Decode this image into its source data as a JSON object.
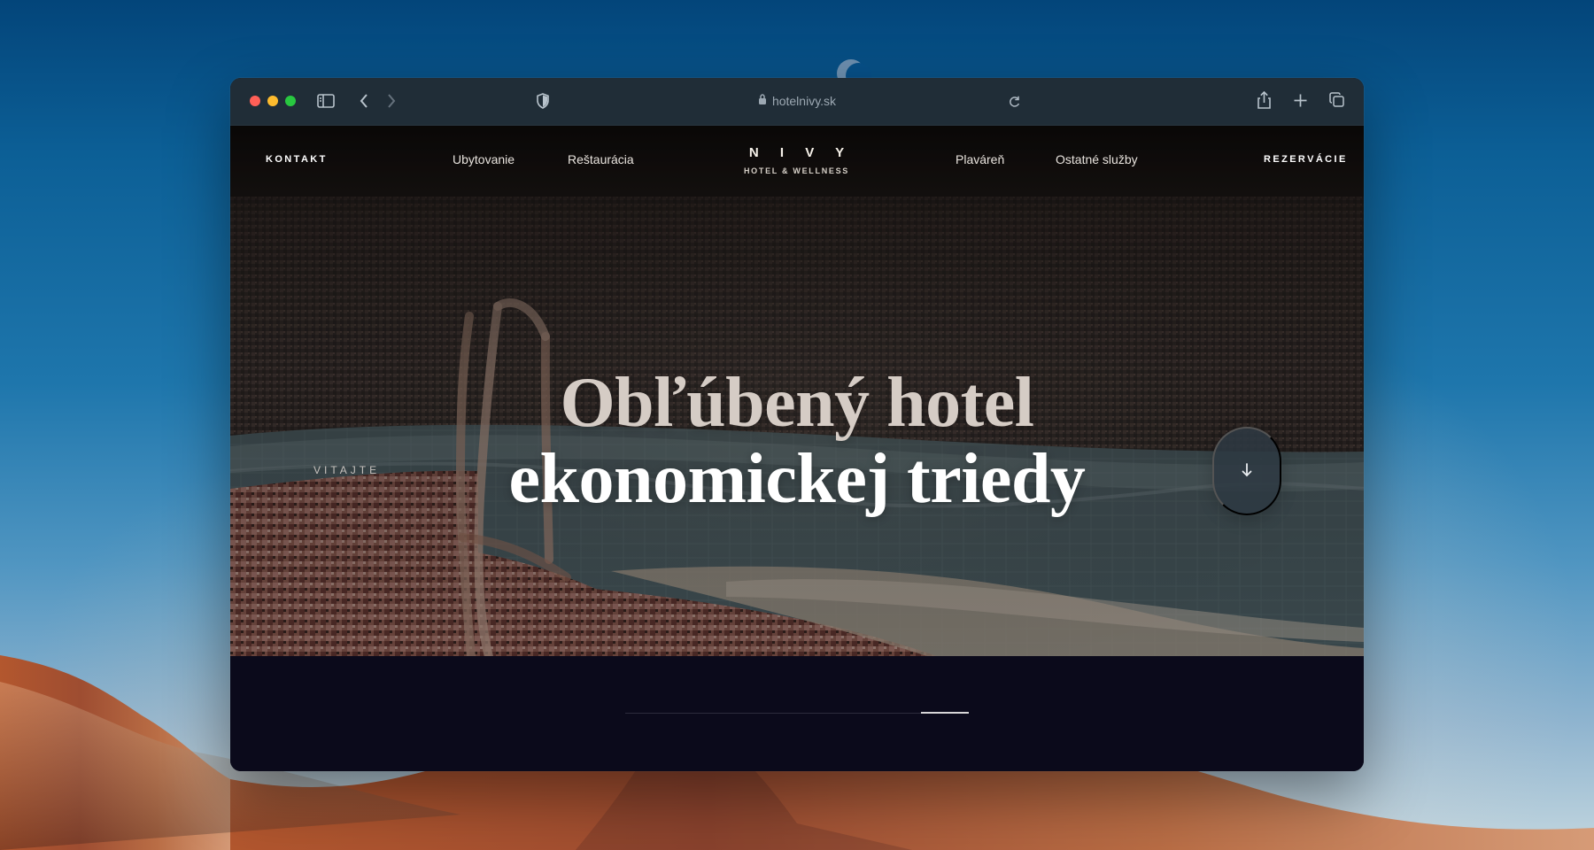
{
  "browser": {
    "url": "hotelnivy.sk",
    "forward_enabled": false
  },
  "navigation": {
    "contact_label": "KONTAKT",
    "accommodation_label": "Ubytovanie",
    "restaurant_label": "Reštaurácia",
    "pool_label": "Plaváreň",
    "other_services_label": "Ostatné služby",
    "reservations_label": "REZERVÁCIE"
  },
  "brand": {
    "name": "N I V Y",
    "subtitle": "HOTEL & WELLNESS"
  },
  "hero": {
    "welcome_label": "VITAJTE",
    "headline_line_1": "Obľúbený hotel",
    "headline_line_2": "ekonomickej triedy"
  },
  "slider": {
    "active_position": 0.86
  },
  "icons": {
    "sidebar": "sidebar-icon",
    "back": "chevron-left-icon",
    "forward": "chevron-right-icon",
    "privacy": "shield-icon",
    "lock": "lock-icon",
    "reload": "reload-icon",
    "share": "share-icon",
    "new_tab": "plus-icon",
    "tabs": "tabs-icon",
    "scroll": "arrow-down-icon"
  },
  "colors": {
    "browser_toolbar": "#202d37",
    "page_dark": "#0b0a1b",
    "headline_muted": "#d5ccc5",
    "headline_white": "#ffffff",
    "scroll_button": "#2d3942"
  }
}
